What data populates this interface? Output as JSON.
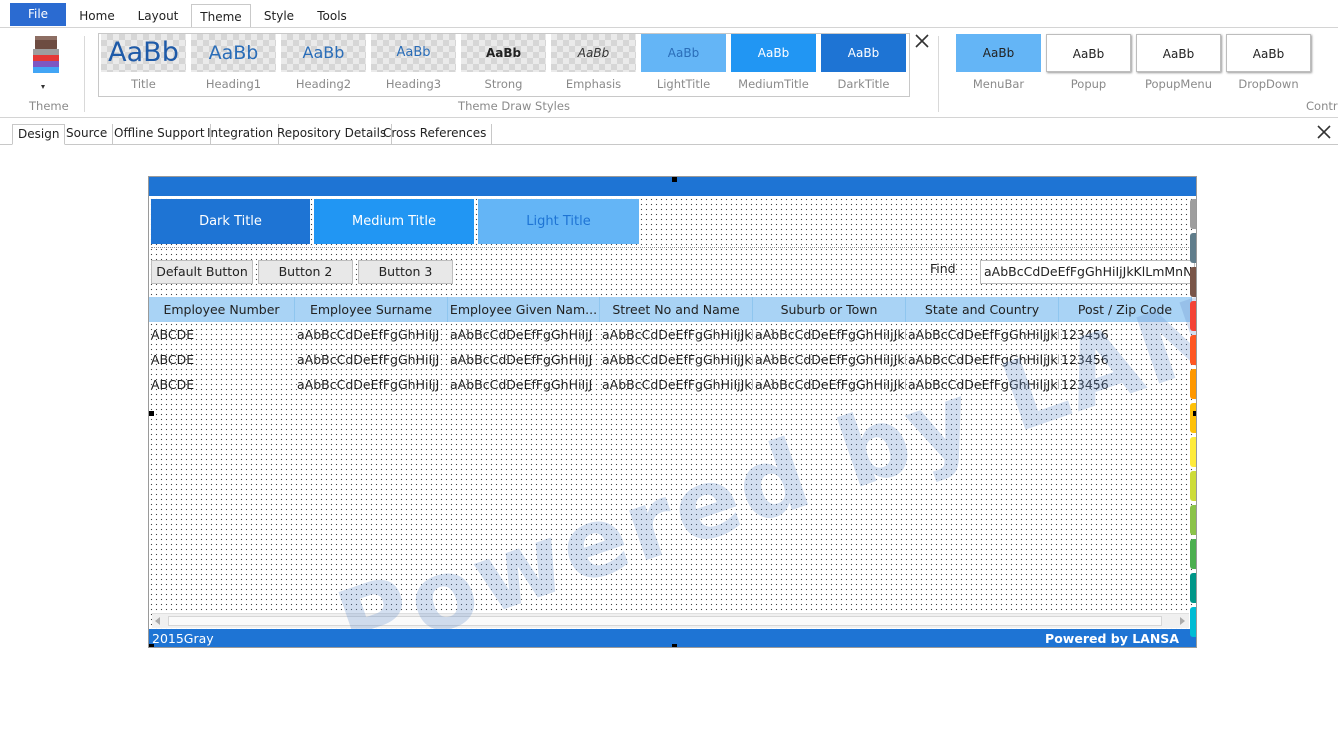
{
  "ribbon_tabs": [
    "File",
    "Home",
    "Layout",
    "Theme",
    "Style",
    "Tools"
  ],
  "active_tab": "Theme",
  "theme_group": {
    "label": "Theme"
  },
  "draw_styles": {
    "group_label": "Theme Draw Styles",
    "items": [
      {
        "label": "Title",
        "sample": "AaBb",
        "style": "checker"
      },
      {
        "label": "Heading1",
        "sample": "AaBb",
        "style": "checker"
      },
      {
        "label": "Heading2",
        "sample": "AaBb",
        "style": "checker"
      },
      {
        "label": "Heading3",
        "sample": "AaBb",
        "style": "checker"
      },
      {
        "label": "Strong",
        "sample": "AaBb",
        "style": "checker"
      },
      {
        "label": "Emphasis",
        "sample": "AaBb",
        "style": "checker"
      },
      {
        "label": "LightTitle",
        "sample": "AaBb",
        "style": "light"
      },
      {
        "label": "MediumTitle",
        "sample": "AaBb",
        "style": "medium"
      },
      {
        "label": "DarkTitle",
        "sample": "AaBb",
        "style": "dark"
      }
    ]
  },
  "controls": {
    "group_label": "Contro",
    "items": [
      {
        "label": "MenuBar",
        "sample": "AaBb"
      },
      {
        "label": "Popup",
        "sample": "AaBb"
      },
      {
        "label": "PopupMenu",
        "sample": "AaBb"
      },
      {
        "label": "DropDown",
        "sample": "AaBb"
      }
    ]
  },
  "doc_tabs": [
    "Design",
    "Source",
    "Offline Support",
    "Integration",
    "Repository Details",
    "Cross References"
  ],
  "form": {
    "title_buttons": [
      "Dark Title",
      "Medium Title",
      "Light Title"
    ],
    "buttons": [
      "Default Button",
      "Button 2",
      "Button 3"
    ],
    "find_label": "Find",
    "find_value": "aAbBcCdDeEfFgGhHiIjJkKlLmMnNo",
    "columns": [
      "Employee Number",
      "Employee Surname",
      "Employee Given Nam...",
      "Street No and Name",
      "Suburb or Town",
      "State and Country",
      "Post / Zip Code"
    ],
    "rows": [
      [
        "ABCDE",
        "aAbBcCdDeEfFgGhHiIjJ",
        "aAbBcCdDeEfFgGhHiIjJ",
        "aAbBcCdDeEfFgGhHiIjJkl",
        "aAbBcCdDeEfFgGhHiIjJkl",
        "aAbBcCdDeEfFgGhHiIjJkl",
        "123456"
      ],
      [
        "ABCDE",
        "aAbBcCdDeEfFgGhHiIjJ",
        "aAbBcCdDeEfFgGhHiIjJ",
        "aAbBcCdDeEfFgGhHiIjJkl",
        "aAbBcCdDeEfFgGhHiIjJkl",
        "aAbBcCdDeEfFgGhHiIjJkl",
        "123456"
      ],
      [
        "ABCDE",
        "aAbBcCdDeEfFgGhHiIjJ",
        "aAbBcCdDeEfFgGhHiIjJ",
        "aAbBcCdDeEfFgGhHiIjJkl",
        "aAbBcCdDeEfFgGhHiIjJkl",
        "aAbBcCdDeEfFgGhHiIjJkl",
        "123456"
      ]
    ],
    "watermark": "Powered by LANSA",
    "footer_left": "2015Gray",
    "footer_right": "Powered by LANSA",
    "side_chip_colors": [
      "#9e9e9e",
      "#607d8b",
      "#795548",
      "#f44336",
      "#ff5722",
      "#ff9800",
      "#ffc107",
      "#ffeb3b",
      "#cddc39",
      "#8bc34a",
      "#4caf50",
      "#009688",
      "#00bcd4"
    ]
  },
  "colors": {
    "accent": "#1e74d4",
    "medium": "#2196f3",
    "light": "#64b5f6",
    "header": "#a9d3f5"
  }
}
